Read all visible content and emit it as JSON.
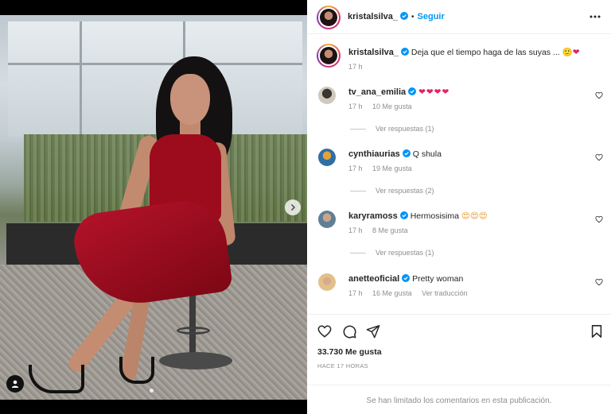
{
  "post": {
    "author": "kristalsilva_",
    "follow_label": "Seguir",
    "separator": "•",
    "caption": {
      "username": "kristalsilva_",
      "text": "Deja que el tiempo haga de las suyas ...",
      "emojis": "🙂❤",
      "time": "17 h"
    },
    "likes": "33.730 Me gusta",
    "posted_ago": "HACE 17 HORAS",
    "comments_limited": "Se han limitado los comentarios en esta publicación."
  },
  "comments": [
    {
      "username": "tv_ana_emilia",
      "text": "❤❤❤❤",
      "time": "17 h",
      "likes": "10 Me gusta",
      "replies": "Ver respuestas (1)",
      "avatar_color": "#cfc9bd"
    },
    {
      "username": "cynthiaurias",
      "text": "Q shula",
      "time": "17 h",
      "likes": "19 Me gusta",
      "replies": "Ver respuestas (2)",
      "avatar_color": "#2f6fa3"
    },
    {
      "username": "karyramoss",
      "text": "Hermosisima",
      "emojis": "😍😍😍",
      "time": "17 h",
      "likes": "8 Me gusta",
      "replies": "Ver respuestas (1)",
      "avatar_color": "#5f7f96"
    },
    {
      "username": "anetteoficial",
      "text": "Pretty woman",
      "time": "17 h",
      "likes": "16 Me gusta",
      "translate": "Ver traducción",
      "avatar_color": "#e2c08b"
    }
  ],
  "icons": {
    "more": "more-options-icon",
    "verified": "verified-badge-icon",
    "like": "heart-icon",
    "comment": "comment-icon",
    "share": "share-icon",
    "save": "bookmark-icon",
    "next": "chevron-right-icon",
    "tag": "user-tag-icon"
  },
  "colors": {
    "accent": "#0095f6",
    "verified": "#0095f6",
    "secondary_text": "#8e8e8e"
  }
}
